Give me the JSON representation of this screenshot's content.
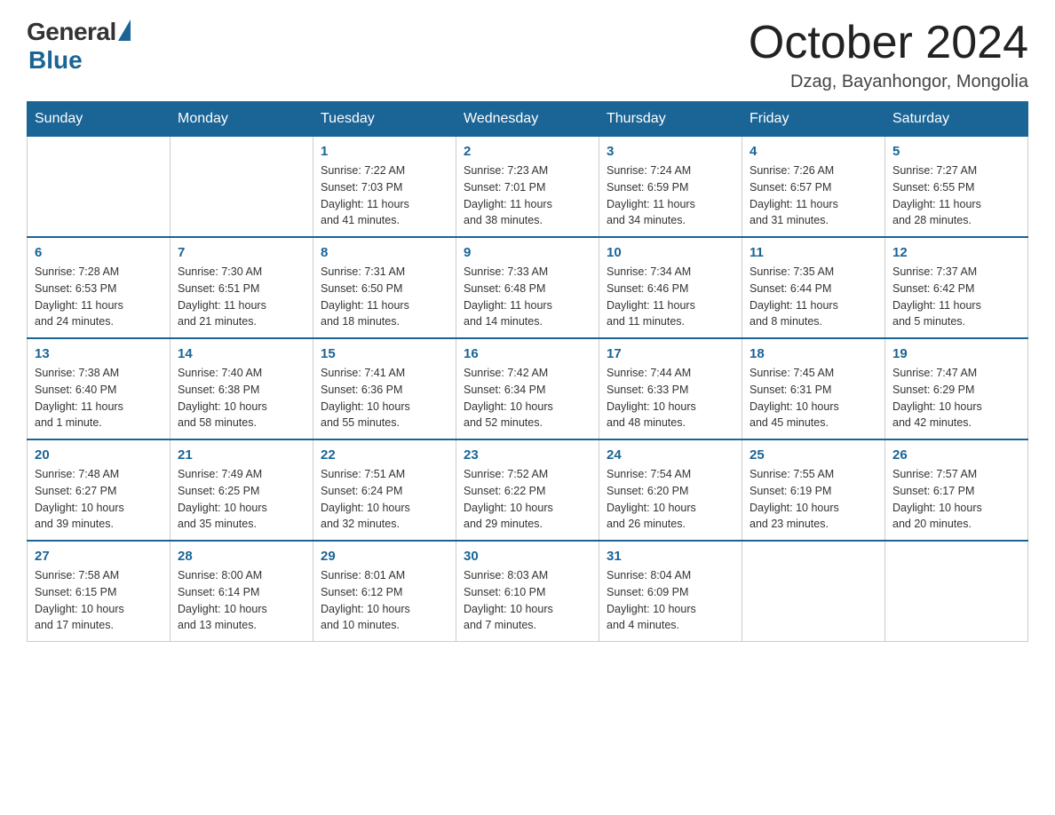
{
  "header": {
    "logo_general": "General",
    "logo_blue": "Blue",
    "month_title": "October 2024",
    "location": "Dzag, Bayanhongor, Mongolia"
  },
  "days_of_week": [
    "Sunday",
    "Monday",
    "Tuesday",
    "Wednesday",
    "Thursday",
    "Friday",
    "Saturday"
  ],
  "weeks": [
    [
      {
        "day": "",
        "info": ""
      },
      {
        "day": "",
        "info": ""
      },
      {
        "day": "1",
        "info": "Sunrise: 7:22 AM\nSunset: 7:03 PM\nDaylight: 11 hours\nand 41 minutes."
      },
      {
        "day": "2",
        "info": "Sunrise: 7:23 AM\nSunset: 7:01 PM\nDaylight: 11 hours\nand 38 minutes."
      },
      {
        "day": "3",
        "info": "Sunrise: 7:24 AM\nSunset: 6:59 PM\nDaylight: 11 hours\nand 34 minutes."
      },
      {
        "day": "4",
        "info": "Sunrise: 7:26 AM\nSunset: 6:57 PM\nDaylight: 11 hours\nand 31 minutes."
      },
      {
        "day": "5",
        "info": "Sunrise: 7:27 AM\nSunset: 6:55 PM\nDaylight: 11 hours\nand 28 minutes."
      }
    ],
    [
      {
        "day": "6",
        "info": "Sunrise: 7:28 AM\nSunset: 6:53 PM\nDaylight: 11 hours\nand 24 minutes."
      },
      {
        "day": "7",
        "info": "Sunrise: 7:30 AM\nSunset: 6:51 PM\nDaylight: 11 hours\nand 21 minutes."
      },
      {
        "day": "8",
        "info": "Sunrise: 7:31 AM\nSunset: 6:50 PM\nDaylight: 11 hours\nand 18 minutes."
      },
      {
        "day": "9",
        "info": "Sunrise: 7:33 AM\nSunset: 6:48 PM\nDaylight: 11 hours\nand 14 minutes."
      },
      {
        "day": "10",
        "info": "Sunrise: 7:34 AM\nSunset: 6:46 PM\nDaylight: 11 hours\nand 11 minutes."
      },
      {
        "day": "11",
        "info": "Sunrise: 7:35 AM\nSunset: 6:44 PM\nDaylight: 11 hours\nand 8 minutes."
      },
      {
        "day": "12",
        "info": "Sunrise: 7:37 AM\nSunset: 6:42 PM\nDaylight: 11 hours\nand 5 minutes."
      }
    ],
    [
      {
        "day": "13",
        "info": "Sunrise: 7:38 AM\nSunset: 6:40 PM\nDaylight: 11 hours\nand 1 minute."
      },
      {
        "day": "14",
        "info": "Sunrise: 7:40 AM\nSunset: 6:38 PM\nDaylight: 10 hours\nand 58 minutes."
      },
      {
        "day": "15",
        "info": "Sunrise: 7:41 AM\nSunset: 6:36 PM\nDaylight: 10 hours\nand 55 minutes."
      },
      {
        "day": "16",
        "info": "Sunrise: 7:42 AM\nSunset: 6:34 PM\nDaylight: 10 hours\nand 52 minutes."
      },
      {
        "day": "17",
        "info": "Sunrise: 7:44 AM\nSunset: 6:33 PM\nDaylight: 10 hours\nand 48 minutes."
      },
      {
        "day": "18",
        "info": "Sunrise: 7:45 AM\nSunset: 6:31 PM\nDaylight: 10 hours\nand 45 minutes."
      },
      {
        "day": "19",
        "info": "Sunrise: 7:47 AM\nSunset: 6:29 PM\nDaylight: 10 hours\nand 42 minutes."
      }
    ],
    [
      {
        "day": "20",
        "info": "Sunrise: 7:48 AM\nSunset: 6:27 PM\nDaylight: 10 hours\nand 39 minutes."
      },
      {
        "day": "21",
        "info": "Sunrise: 7:49 AM\nSunset: 6:25 PM\nDaylight: 10 hours\nand 35 minutes."
      },
      {
        "day": "22",
        "info": "Sunrise: 7:51 AM\nSunset: 6:24 PM\nDaylight: 10 hours\nand 32 minutes."
      },
      {
        "day": "23",
        "info": "Sunrise: 7:52 AM\nSunset: 6:22 PM\nDaylight: 10 hours\nand 29 minutes."
      },
      {
        "day": "24",
        "info": "Sunrise: 7:54 AM\nSunset: 6:20 PM\nDaylight: 10 hours\nand 26 minutes."
      },
      {
        "day": "25",
        "info": "Sunrise: 7:55 AM\nSunset: 6:19 PM\nDaylight: 10 hours\nand 23 minutes."
      },
      {
        "day": "26",
        "info": "Sunrise: 7:57 AM\nSunset: 6:17 PM\nDaylight: 10 hours\nand 20 minutes."
      }
    ],
    [
      {
        "day": "27",
        "info": "Sunrise: 7:58 AM\nSunset: 6:15 PM\nDaylight: 10 hours\nand 17 minutes."
      },
      {
        "day": "28",
        "info": "Sunrise: 8:00 AM\nSunset: 6:14 PM\nDaylight: 10 hours\nand 13 minutes."
      },
      {
        "day": "29",
        "info": "Sunrise: 8:01 AM\nSunset: 6:12 PM\nDaylight: 10 hours\nand 10 minutes."
      },
      {
        "day": "30",
        "info": "Sunrise: 8:03 AM\nSunset: 6:10 PM\nDaylight: 10 hours\nand 7 minutes."
      },
      {
        "day": "31",
        "info": "Sunrise: 8:04 AM\nSunset: 6:09 PM\nDaylight: 10 hours\nand 4 minutes."
      },
      {
        "day": "",
        "info": ""
      },
      {
        "day": "",
        "info": ""
      }
    ]
  ]
}
